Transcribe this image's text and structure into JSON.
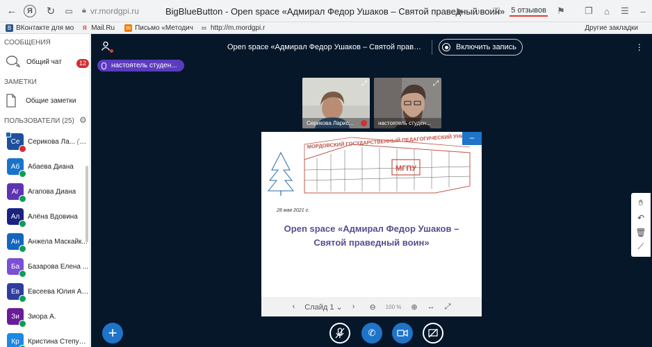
{
  "browser": {
    "url": "vr.mordgpi.ru",
    "page_title": "BigBlueButton - Open space «Адмирал Федор Ушаков – Святой праведный воин»",
    "reviews": "5 отзывов",
    "bookmarks": [
      {
        "label": "ВКонтакте для мо",
        "color": "#2a5885",
        "glyph": "В"
      },
      {
        "label": "Mail.Ru",
        "color": "#ffffff",
        "glyph": "Я"
      },
      {
        "label": "Письмо «Методич",
        "color": "#f57c00",
        "glyph": "✉"
      },
      {
        "label": "http://m.mordgpi.r",
        "color": "#ffffff",
        "glyph": "m"
      }
    ],
    "other_bookmarks": "Другие закладки"
  },
  "sidebar": {
    "messages_title": "СООБЩЕНИЯ",
    "public_chat": "Общий чат",
    "unread": "12",
    "notes_title": "ЗАМЕТКИ",
    "shared_notes": "Общие заметки",
    "users_title": "ПОЛЬЗОВАТЕЛИ (25)",
    "users": [
      {
        "initials": "Се",
        "name": "Серикова Ла...",
        "you": "(Вы)",
        "color": "#1e4f9c",
        "mic": "red",
        "presenter": true
      },
      {
        "initials": "Аб",
        "name": "Абаева Диана",
        "color": "#1a73c9",
        "mic": "green"
      },
      {
        "initials": "Аг",
        "name": "Агапова Диана",
        "color": "#5e35b1",
        "mic": "green"
      },
      {
        "initials": "Ал",
        "name": "Алёна Вдовина",
        "color": "#1a237e",
        "mic": "green"
      },
      {
        "initials": "Ан",
        "name": "Анжела Маскайк...",
        "color": "#1565c0",
        "mic": "green"
      },
      {
        "initials": "Ба",
        "name": "Базарова Елена ...",
        "color": "#7b4fd6",
        "mic": "green"
      },
      {
        "initials": "Ев",
        "name": "Евсеева Юлия Ал...",
        "color": "#2f3d9e",
        "mic": "green"
      },
      {
        "initials": "Зи",
        "name": "Зиора А.",
        "color": "#6a1b9a",
        "mic": "green"
      },
      {
        "initials": "Кр",
        "name": "Кристина Степуш...",
        "color": "#1e88e5",
        "mic": "green"
      }
    ]
  },
  "main": {
    "meeting_title": "Open space «Адмирал Федор Ушаков – Святой праведный во...",
    "record_label": "Включить запись",
    "talking": "настоятель студен...",
    "videos": [
      {
        "name": "Серикова Ларис...",
        "muted": true
      },
      {
        "name": "настоятель студен...",
        "muted": false
      }
    ],
    "slide": {
      "date": "28 мая 2021 г.",
      "title_line1": "Open space «Адмирал Федор Ушаков –",
      "title_line2": "Святой праведный воин»",
      "university": "МОРДОВСКИЙ ГОСУДАРСТВЕННЫЙ ПЕДАГОГИЧЕСКИЙ УНИВЕРСИТЕТ",
      "logo": "МГПУ",
      "min_label": "–",
      "slide_label": "Слайд 1",
      "zoom": "100 %"
    }
  },
  "colors": {
    "main_bg": "#06172a",
    "accent": "#1e74c9",
    "talker": "#5b3bbf",
    "slide_title": "#5c4c8f"
  }
}
